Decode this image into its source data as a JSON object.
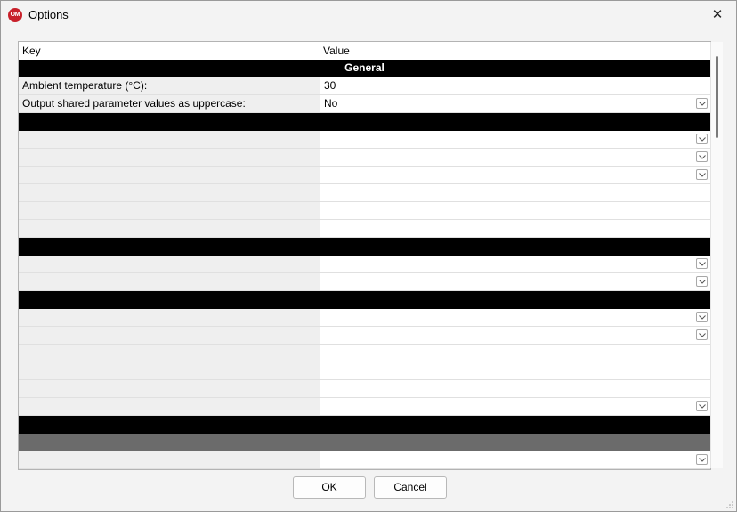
{
  "window": {
    "title": "Options",
    "app_icon_text": "OM",
    "close_glyph": "✕"
  },
  "grid": {
    "columns": [
      "Key",
      "Value"
    ],
    "rows": [
      {
        "type": "section",
        "label": "General"
      },
      {
        "type": "row",
        "key": "Ambient temperature (°C):",
        "value": "30",
        "dropdown": false
      },
      {
        "type": "row",
        "key": "Output shared parameter values as uppercase:",
        "value": "No",
        "dropdown": true
      },
      {
        "type": "section",
        "label": ""
      },
      {
        "type": "row",
        "key": "",
        "value": "",
        "dropdown": true
      },
      {
        "type": "row",
        "key": "",
        "value": "",
        "dropdown": true
      },
      {
        "type": "row",
        "key": "",
        "value": "",
        "dropdown": true
      },
      {
        "type": "row",
        "key": "",
        "value": "",
        "dropdown": false
      },
      {
        "type": "row",
        "key": "",
        "value": "",
        "dropdown": false
      },
      {
        "type": "row",
        "key": "",
        "value": "",
        "dropdown": false
      },
      {
        "type": "section",
        "label": ""
      },
      {
        "type": "row",
        "key": "",
        "value": "",
        "dropdown": true
      },
      {
        "type": "row",
        "key": "",
        "value": "",
        "dropdown": true
      },
      {
        "type": "section",
        "label": ""
      },
      {
        "type": "row",
        "key": "",
        "value": "",
        "dropdown": true
      },
      {
        "type": "row",
        "key": "",
        "value": "",
        "dropdown": true
      },
      {
        "type": "row",
        "key": "",
        "value": "",
        "dropdown": false
      },
      {
        "type": "row",
        "key": "",
        "value": "",
        "dropdown": false
      },
      {
        "type": "row",
        "key": "",
        "value": "",
        "dropdown": false
      },
      {
        "type": "row",
        "key": "",
        "value": "",
        "dropdown": true
      },
      {
        "type": "section",
        "label": ""
      },
      {
        "type": "subsection",
        "label": ""
      },
      {
        "type": "row",
        "key": "",
        "value": "",
        "dropdown": true
      }
    ]
  },
  "buttons": {
    "ok": "OK",
    "cancel": "Cancel"
  }
}
